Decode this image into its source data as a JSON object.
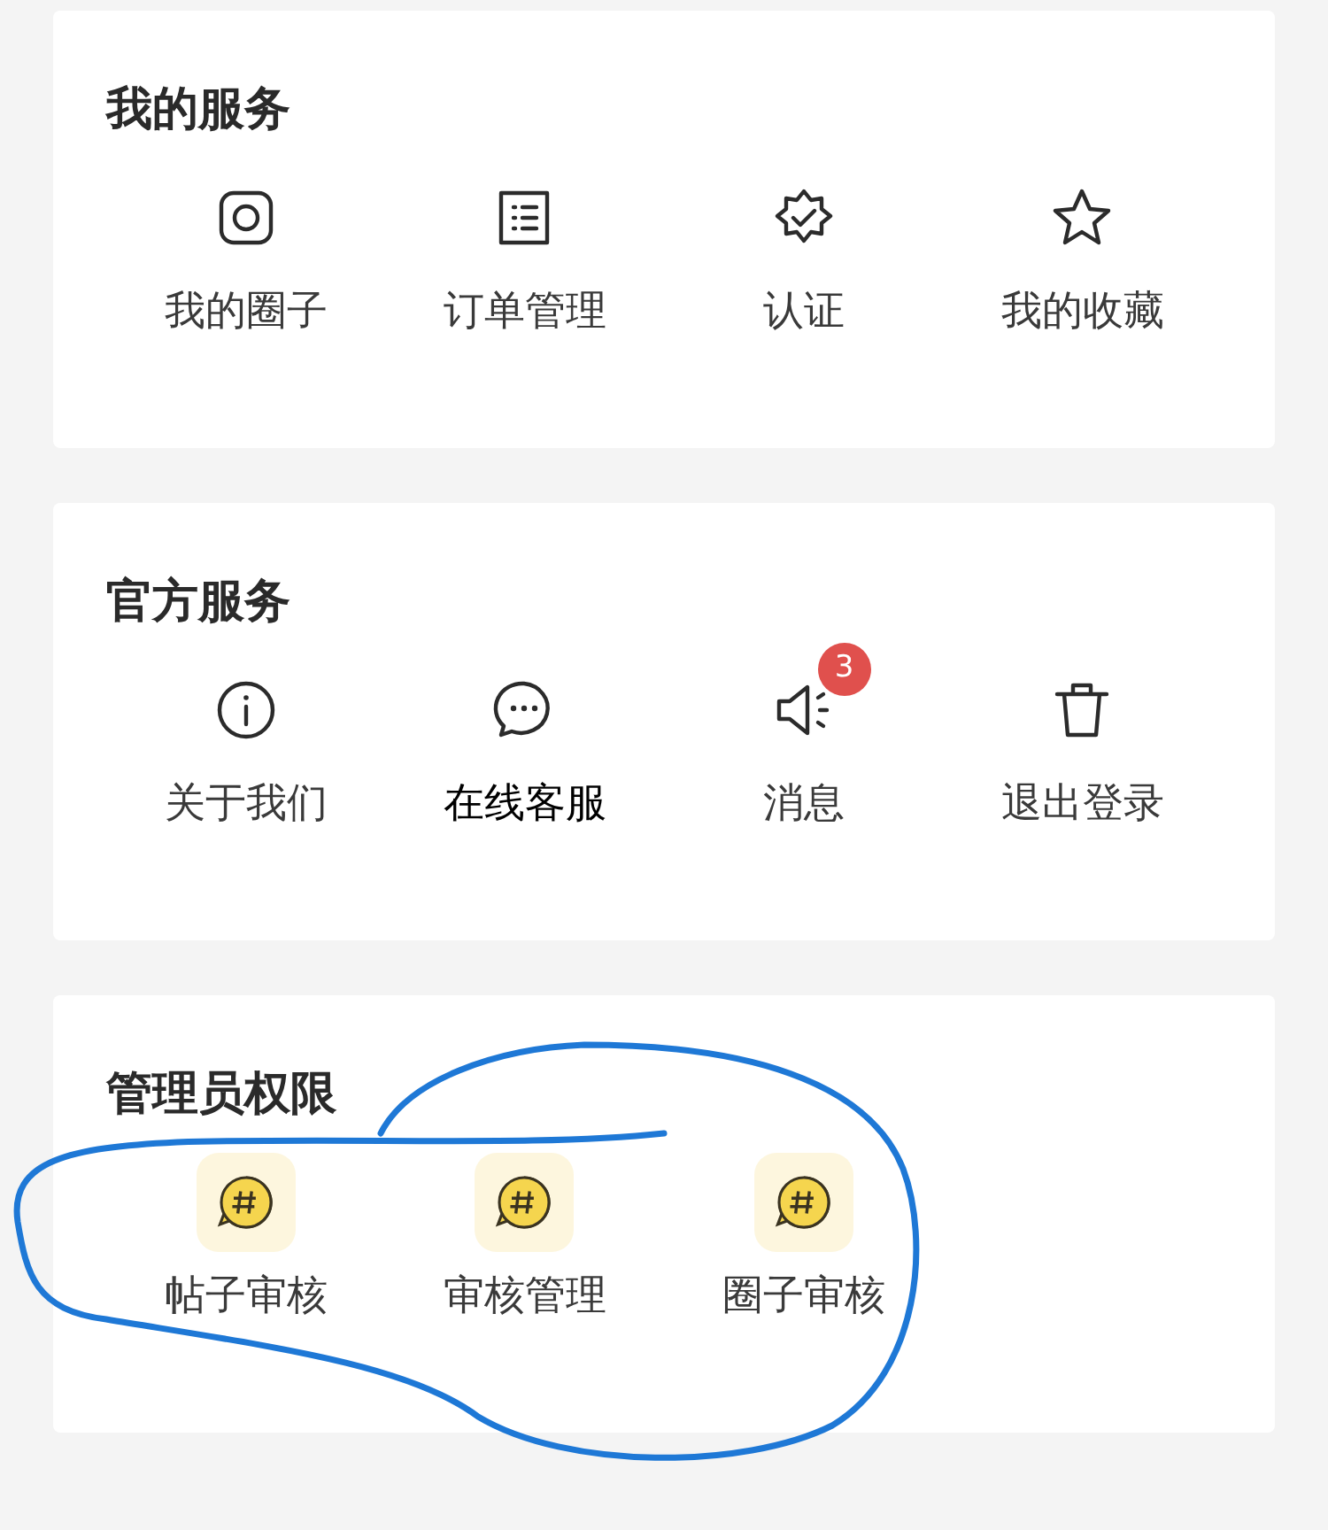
{
  "sections": [
    {
      "title": "我的服务",
      "items": [
        {
          "label": "我的圈子",
          "kind": "camera",
          "emphasized": false
        },
        {
          "label": "订单管理",
          "kind": "list",
          "emphasized": false
        },
        {
          "label": "认证",
          "kind": "badge",
          "emphasized": false
        },
        {
          "label": "我的收藏",
          "kind": "star",
          "emphasized": false
        }
      ]
    },
    {
      "title": "官方服务",
      "items": [
        {
          "label": "关于我们",
          "kind": "info",
          "emphasized": false
        },
        {
          "label": "在线客服",
          "kind": "chat",
          "emphasized": true
        },
        {
          "label": "消息",
          "kind": "speaker",
          "emphasized": false,
          "badge": "3"
        },
        {
          "label": "退出登录",
          "kind": "trash",
          "emphasized": false
        }
      ]
    },
    {
      "title": "管理员权限",
      "items": [
        {
          "label": "帖子审核",
          "kind": "hashtag",
          "emphasized": false
        },
        {
          "label": "审核管理",
          "kind": "hashtag",
          "emphasized": false
        },
        {
          "label": "圈子审核",
          "kind": "hashtag",
          "emphasized": false
        }
      ]
    }
  ],
  "annotation": {
    "kind": "freehand-circle",
    "color": "#1e78d6"
  }
}
